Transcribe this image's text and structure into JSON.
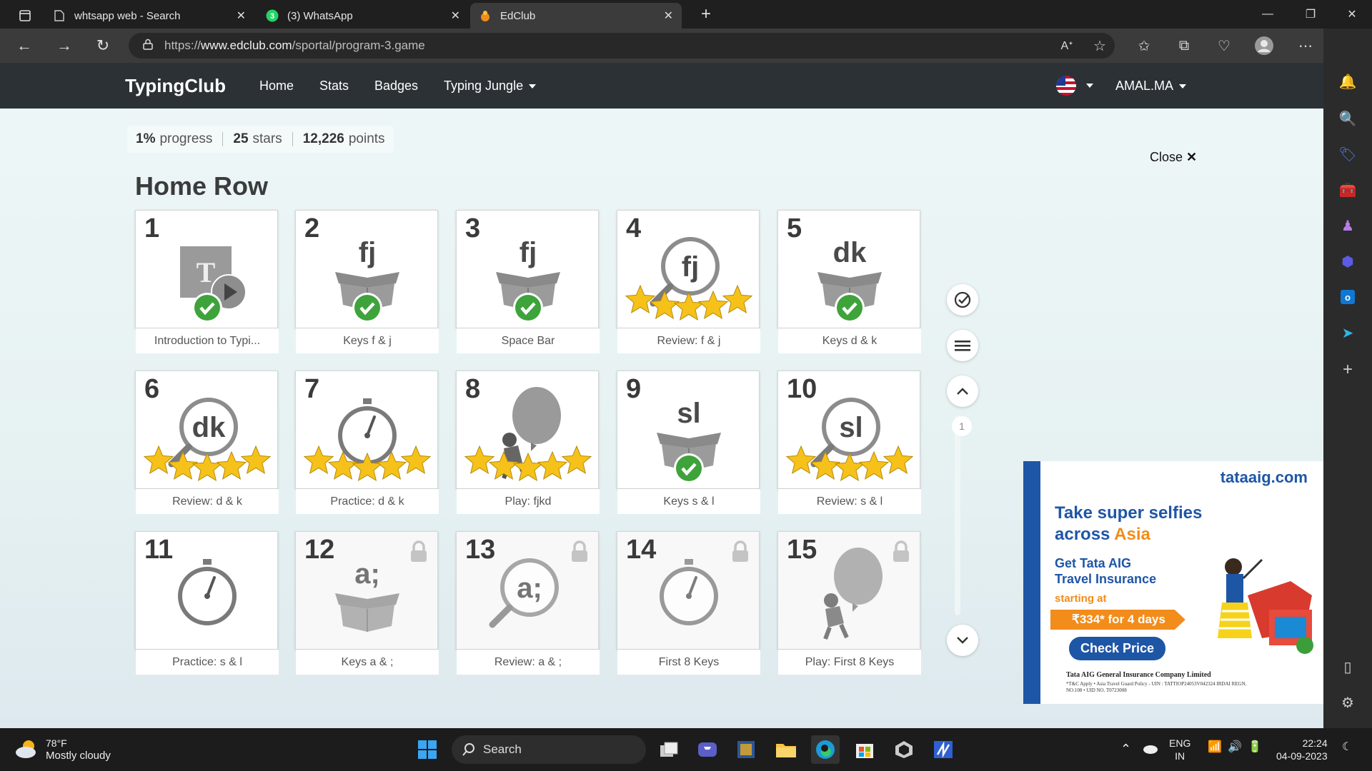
{
  "browser": {
    "tabs": [
      {
        "title": "whtsapp web - Search",
        "active": false
      },
      {
        "title": "(3) WhatsApp",
        "badge": "3",
        "active": false
      },
      {
        "title": "EdClub",
        "active": true
      }
    ],
    "url_prefix": "https://",
    "url_domain": "www.edclub.com",
    "url_path": "/sportal/program-3.game"
  },
  "site": {
    "brand": "TypingClub",
    "nav": [
      "Home",
      "Stats",
      "Badges",
      "Typing Jungle"
    ],
    "user": "AMAL.MA"
  },
  "progress": {
    "percent": "1%",
    "percent_label": "progress",
    "stars": "25",
    "stars_label": "stars",
    "points": "12,226",
    "points_label": "points"
  },
  "close_label": "Close",
  "section_title": "Home Row",
  "lessons": [
    {
      "num": "1",
      "label": "Introduction to Typi...",
      "kind": "video",
      "status": "done"
    },
    {
      "num": "2",
      "label": "Keys f & j",
      "kind": "box",
      "glyph": "fj",
      "status": "done"
    },
    {
      "num": "3",
      "label": "Space Bar",
      "kind": "box",
      "glyph": "fj",
      "status": "done"
    },
    {
      "num": "4",
      "label": "Review: f & j",
      "kind": "magnifier",
      "glyph": "fj",
      "status": "stars",
      "stars": 5
    },
    {
      "num": "5",
      "label": "Keys d & k",
      "kind": "box",
      "glyph": "dk",
      "status": "done"
    },
    {
      "num": "6",
      "label": "Review: d & k",
      "kind": "magnifier",
      "glyph": "dk",
      "status": "stars",
      "stars": 5
    },
    {
      "num": "7",
      "label": "Practice: d & k",
      "kind": "stopwatch",
      "status": "stars",
      "stars": 5
    },
    {
      "num": "8",
      "label": "Play: fjkd",
      "kind": "game",
      "status": "stars",
      "stars": 5
    },
    {
      "num": "9",
      "label": "Keys s & l",
      "kind": "box",
      "glyph": "sl",
      "status": "done"
    },
    {
      "num": "10",
      "label": "Review: s & l",
      "kind": "magnifier",
      "glyph": "sl",
      "status": "stars",
      "stars": 5
    },
    {
      "num": "11",
      "label": "Practice: s & l",
      "kind": "stopwatch",
      "status": "open"
    },
    {
      "num": "12",
      "label": "Keys a & ;",
      "kind": "box",
      "glyph": "a;",
      "status": "locked"
    },
    {
      "num": "13",
      "label": "Review: a & ;",
      "kind": "magnifier",
      "glyph": "a;",
      "status": "locked"
    },
    {
      "num": "14",
      "label": "First 8 Keys",
      "kind": "stopwatch",
      "status": "locked"
    },
    {
      "num": "15",
      "label": "Play: First 8 Keys",
      "kind": "game",
      "status": "locked"
    }
  ],
  "page_indicator": "1",
  "ad": {
    "brand": "tataaig.com",
    "headline_1": "Take super selfies",
    "headline_2a": "across ",
    "headline_2b": "Asia",
    "sub_1": "Get Tata AIG",
    "sub_2": "Travel Insurance",
    "starting_at": "starting at",
    "price": "₹334* for 4 days",
    "cta": "Check Price",
    "legal_1": "Tata AIG General Insurance Company Limited",
    "legal_2": "*T&C Apply • Asia Travel Guard Policy - UIN : TATTIOP24053V042324 IRDAI REGN. NO.108 • UID NO. T0723008"
  },
  "taskbar": {
    "weather_temp": "78°F",
    "weather_desc": "Mostly cloudy",
    "search_label": "Search",
    "lang_1": "ENG",
    "lang_2": "IN",
    "time": "22:24",
    "date": "04-09-2023"
  },
  "colors": {
    "nav_bg": "#2c3136",
    "check_green": "#3ea33a",
    "star_gold": "#f6c21a",
    "ad_blue": "#1e56a6",
    "ad_orange": "#f28c1a"
  }
}
